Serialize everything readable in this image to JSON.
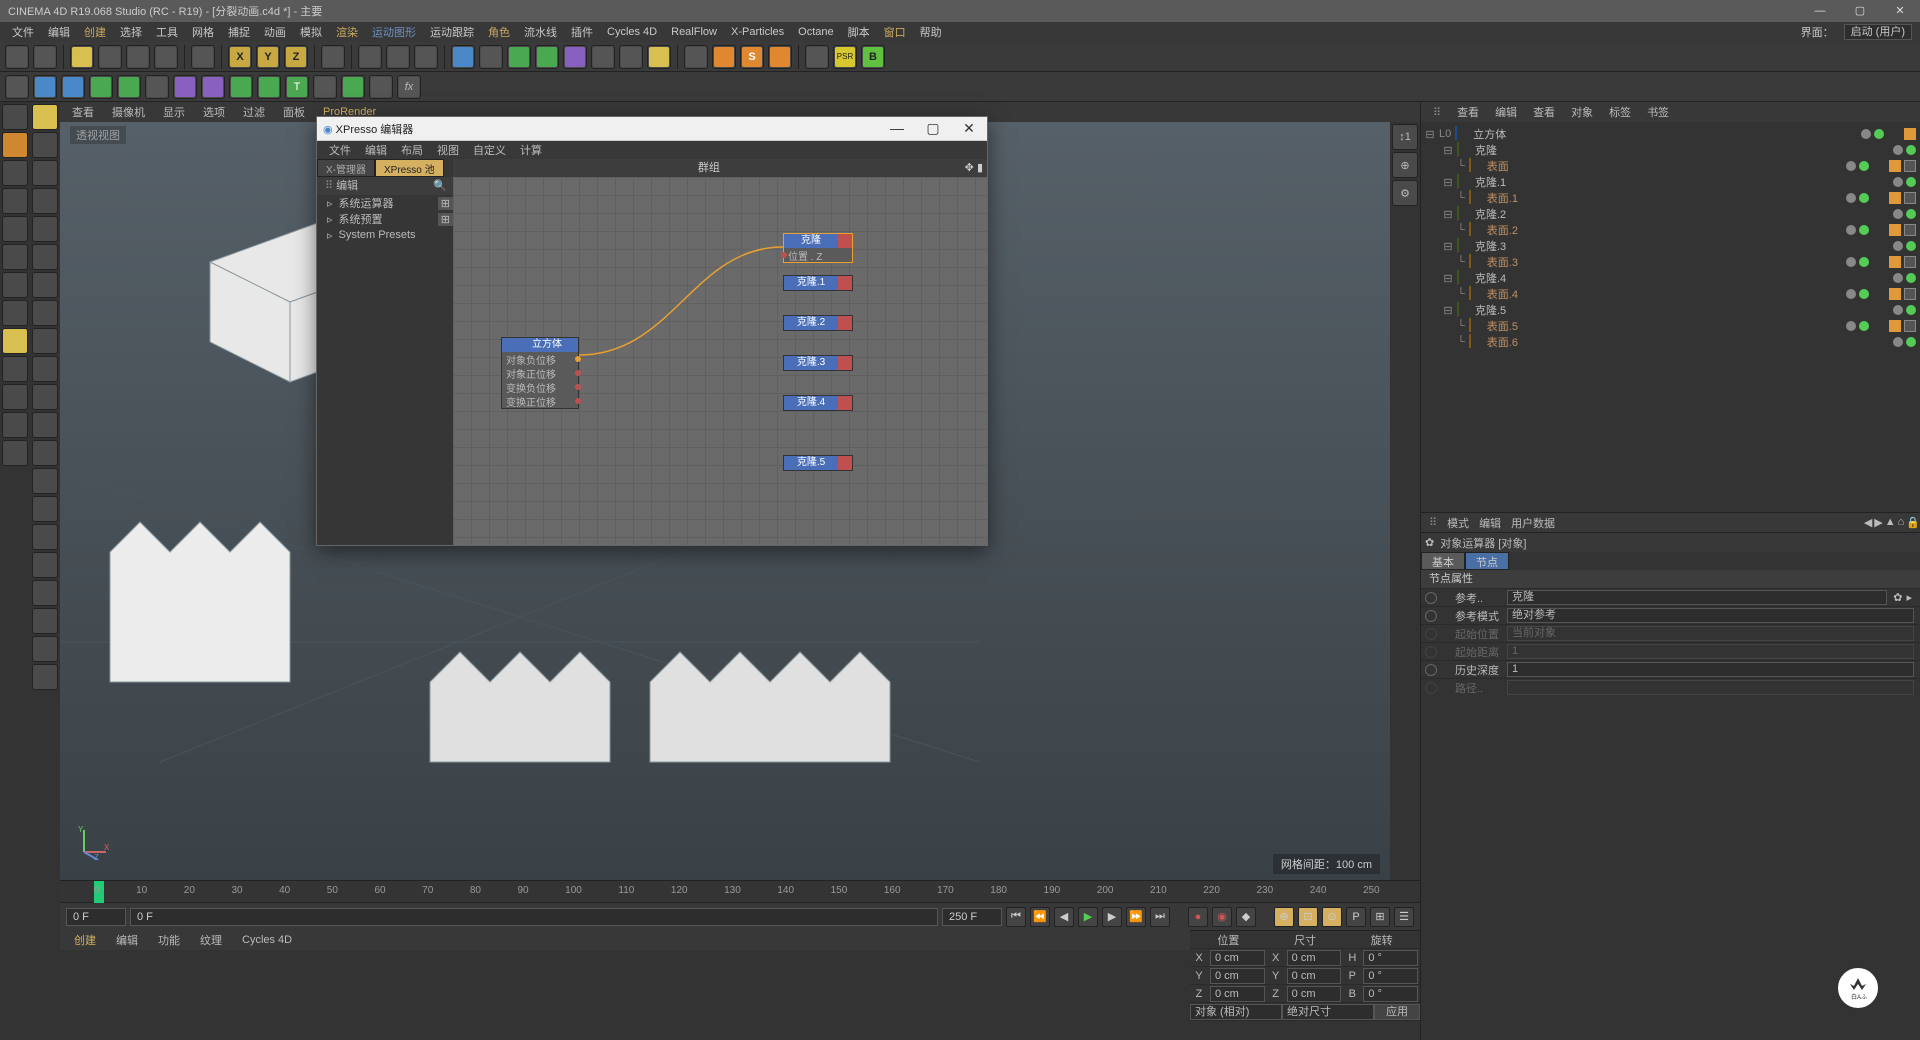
{
  "title_bar": {
    "title": "CINEMA 4D R19.068 Studio (RC - R19) - [分裂动画.c4d *] - 主要"
  },
  "menu_bar": {
    "items": [
      "文件",
      "编辑",
      "创建",
      "选择",
      "工具",
      "网格",
      "捕捉",
      "动画",
      "模拟",
      "渲染",
      "运动图形",
      "运动跟踪",
      "角色",
      "流水线",
      "插件",
      "Cycles 4D",
      "RealFlow",
      "X-Particles",
      "Octane",
      "脚本",
      "窗口",
      "帮助"
    ],
    "right_label": "界面：",
    "right_dropdown": "启动 (用户)"
  },
  "view_tabs": {
    "items": [
      "查看",
      "摄像机",
      "显示",
      "选项",
      "过滤",
      "面板",
      "ProRender"
    ],
    "viewport_name": "透视视图",
    "grid_info": "网格间距：100 cm"
  },
  "timeline": {
    "frames": [
      "0",
      "10",
      "20",
      "30",
      "40",
      "50",
      "60",
      "70",
      "80",
      "90",
      "100",
      "110",
      "120",
      "130",
      "140",
      "150",
      "160",
      "170",
      "180",
      "190",
      "200",
      "210",
      "220",
      "230",
      "240",
      "250"
    ],
    "start": "0 F",
    "current": "0 F",
    "end": "250 F"
  },
  "bottom_tabs": {
    "items": [
      "创建",
      "编辑",
      "功能",
      "纹理",
      "Cycles 4D"
    ]
  },
  "coord_panel": {
    "headers": [
      "位置",
      "尺寸",
      "旋转"
    ],
    "rows": [
      {
        "axis": "X",
        "pos": "0 cm",
        "size": "0 cm",
        "rot": "0 °",
        "sl": "X",
        "hl": "H"
      },
      {
        "axis": "Y",
        "pos": "0 cm",
        "size": "0 cm",
        "rot": "0 °",
        "sl": "Y",
        "hl": "P"
      },
      {
        "axis": "Z",
        "pos": "0 cm",
        "size": "0 cm",
        "rot": "0 °",
        "sl": "Z",
        "hl": "B"
      }
    ],
    "mode1": "对象 (相对)",
    "mode2": "绝对尺寸",
    "apply": "应用"
  },
  "object_mgr": {
    "tabs": [
      "查看",
      "编辑",
      "查看",
      "对象",
      "标签",
      "书签"
    ],
    "root": "立方体",
    "items": [
      {
        "name": "克隆",
        "surf": "表面",
        "i": 0
      },
      {
        "name": "克隆.1",
        "surf": "表面.1",
        "i": 1
      },
      {
        "name": "克隆.2",
        "surf": "表面.2",
        "i": 2
      },
      {
        "name": "克隆.3",
        "surf": "表面.3",
        "i": 3
      },
      {
        "name": "克隆.4",
        "surf": "表面.4",
        "i": 4
      },
      {
        "name": "克隆.5",
        "surf": "表面.5",
        "i": 5
      }
    ],
    "extra_surf": "表面.6"
  },
  "attr_mgr": {
    "tabs": [
      "模式",
      "编辑",
      "用户数据"
    ],
    "obj_type": "对象运算器 [对象]",
    "tab_basic": "基本",
    "tab_node": "节点",
    "section": "节点属性",
    "fields": {
      "ref_label": "参考..",
      "ref_value": "克隆",
      "refmode_label": "参考模式",
      "refmode_value": "绝对参考",
      "startpos_label": "起始位置",
      "startpos_value": "当前对象",
      "startdist_label": "起始距离",
      "startdist_value": "1",
      "hist_label": "历史深度",
      "hist_value": "1",
      "path_label": "路径.."
    }
  },
  "xpresso": {
    "title": "XPresso 编辑器",
    "menu": [
      "文件",
      "编辑",
      "布局",
      "视图",
      "自定义",
      "计算"
    ],
    "left_tab1": "X-管理器",
    "left_tab2": "XPresso 池",
    "edit_label": "编辑",
    "presets": [
      "系统运算器",
      "系统预置",
      "System Presets"
    ],
    "canvas_title": "群组",
    "source_node": {
      "title": "立方体",
      "rows": [
        "对象负位移",
        "对象正位移",
        "变换负位移",
        "变换正位移"
      ]
    },
    "targets": [
      "克隆",
      "克隆.1",
      "克隆.2",
      "克隆.3",
      "克隆.4",
      "克隆.5"
    ],
    "target_port": "位置 . Z"
  }
}
